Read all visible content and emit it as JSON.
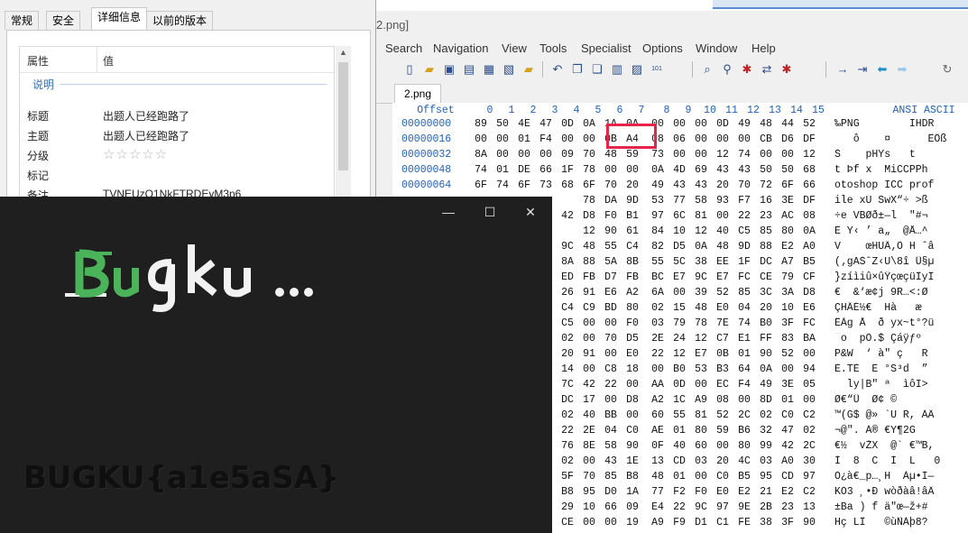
{
  "hex_editor": {
    "title_fragment": "2.png]",
    "menu": [
      "Search",
      "Navigation",
      "View",
      "Tools",
      "Specialist",
      "Options",
      "Window",
      "Help"
    ],
    "tab_label": "2.png",
    "header": {
      "offset": "Offset",
      "columns": [
        "0",
        "1",
        "2",
        "3",
        "4",
        "5",
        "6",
        "7",
        "8",
        "9",
        "10",
        "11",
        "12",
        "13",
        "14",
        "15"
      ],
      "ascii": "ANSI ASCII"
    },
    "rows": [
      {
        "offset": "00000000",
        "hex": [
          "89",
          "50",
          "4E",
          "47",
          "0D",
          "0A",
          "1A",
          "0A",
          "00",
          "00",
          "00",
          "0D",
          "49",
          "48",
          "44",
          "52"
        ],
        "ascii": "‰PNG        IHDR"
      },
      {
        "offset": "00000016",
        "hex": [
          "00",
          "00",
          "01",
          "F4",
          "00",
          "00",
          "0B",
          "A4",
          "08",
          "06",
          "00",
          "00",
          "00",
          "CB",
          "D6",
          "DF"
        ],
        "ascii": "   ô    ¤      ËÖß"
      },
      {
        "offset": "00000032",
        "hex": [
          "8A",
          "00",
          "00",
          "00",
          "09",
          "70",
          "48",
          "59",
          "73",
          "00",
          "00",
          "12",
          "74",
          "00",
          "00",
          "12"
        ],
        "ascii": "Š    pHYs   t  "
      },
      {
        "offset": "00000048",
        "hex": [
          "74",
          "01",
          "DE",
          "66",
          "1F",
          "78",
          "00",
          "00",
          "0A",
          "4D",
          "69",
          "43",
          "43",
          "50",
          "50",
          "68"
        ],
        "ascii": "t Þf x  MiCCPPh"
      },
      {
        "offset": "00000064",
        "hex": [
          "6F",
          "74",
          "6F",
          "73",
          "68",
          "6F",
          "70",
          "20",
          "49",
          "43",
          "43",
          "20",
          "70",
          "72",
          "6F",
          "66"
        ],
        "ascii": "otoshop ICC prof"
      },
      {
        "offset": "",
        "hex": [
          "",
          "",
          "",
          "",
          "",
          "",
          "78",
          "DA",
          "9D",
          "53",
          "77",
          "58",
          "93",
          "F7",
          "16",
          "3E",
          "DF"
        ],
        "ascii": "ile xÚ SwX“÷ >ß"
      },
      {
        "offset": "",
        "hex": [
          "",
          "",
          "",
          "",
          "",
          "",
          "42",
          "D8",
          "F0",
          "B1",
          "97",
          "6C",
          "81",
          "00",
          "22",
          "23",
          "AC",
          "08"
        ],
        "ascii": "÷e VBØð±—l  \"#¬"
      },
      {
        "offset": "",
        "hex": [
          "",
          "",
          "",
          "",
          "",
          "",
          "12",
          "90",
          "61",
          "84",
          "10",
          "12",
          "40",
          "C5",
          "85",
          "80",
          "0A"
        ],
        "ascii": "È Y‹ ’ a„  @Å…^"
      },
      {
        "offset": "",
        "hex": [
          "",
          "",
          "",
          "",
          "",
          "",
          "9C",
          "48",
          "55",
          "C4",
          "82",
          "D5",
          "0A",
          "48",
          "9D",
          "88",
          "E2",
          "A0"
        ],
        "ascii": "V    œHUÄ‚Õ H ˆâ "
      },
      {
        "offset": "",
        "hex": [
          "",
          "",
          "",
          "",
          "",
          "",
          "8A",
          "88",
          "5A",
          "8B",
          "55",
          "5C",
          "38",
          "EE",
          "1F",
          "DC",
          "A7",
          "B5"
        ],
        "ascii": "(‚gAŠˆZ‹U\\8î Ü§µ"
      },
      {
        "offset": "",
        "hex": [
          "",
          "",
          "",
          "",
          "",
          "",
          "ED",
          "FB",
          "D7",
          "FB",
          "BC",
          "E7",
          "9C",
          "E7",
          "FC",
          "CE",
          "79",
          "CF"
        ],
        "ascii": "}zíìiû×ûŸçœçüÎyÏ"
      },
      {
        "offset": "",
        "hex": [
          "",
          "",
          "",
          "",
          "",
          "",
          "26",
          "91",
          "E6",
          "A2",
          "6A",
          "00",
          "39",
          "52",
          "85",
          "3C",
          "3A",
          "D8"
        ],
        "ascii": "€  &‘æ¢j 9R…<:Ø"
      },
      {
        "offset": "",
        "hex": [
          "",
          "",
          "",
          "",
          "",
          "",
          "C4",
          "C9",
          "BD",
          "80",
          "02",
          "15",
          "48",
          "E0",
          "04",
          "20",
          "10",
          "E6"
        ],
        "ascii": "ÇHÄÉ½€  Hà   æ"
      },
      {
        "offset": "",
        "hex": [
          "",
          "",
          "",
          "",
          "",
          "",
          "C5",
          "00",
          "00",
          "F0",
          "03",
          "79",
          "78",
          "7E",
          "74",
          "B0",
          "3F",
          "FC"
        ],
        "ascii": "ËÄg Å  ð yx~t°?ü"
      },
      {
        "offset": "",
        "hex": [
          "",
          "",
          "",
          "",
          "",
          "",
          "02",
          "00",
          "70",
          "D5",
          "2E",
          "24",
          "12",
          "C7",
          "E1",
          "FF",
          "83",
          "BA"
        ],
        "ascii": "¯o  pÕ.$ Çáÿƒº"
      },
      {
        "offset": "",
        "hex": [
          "",
          "",
          "",
          "",
          "",
          "",
          "20",
          "91",
          "00",
          "E0",
          "22",
          "12",
          "E7",
          "0B",
          "01",
          "90",
          "52",
          "00"
        ],
        "ascii": "P&W  ‘ à\" ç   R"
      },
      {
        "offset": "",
        "hex": [
          "",
          "",
          "",
          "",
          "",
          "",
          "14",
          "00",
          "C8",
          "18",
          "00",
          "B0",
          "53",
          "B3",
          "64",
          "0A",
          "00",
          "94"
        ],
        "ascii": "È.TÈ  È °S³d  ”"
      },
      {
        "offset": "",
        "hex": [
          "",
          "",
          "",
          "",
          "",
          "",
          "7C",
          "42",
          "22",
          "00",
          "AA",
          "0D",
          "00",
          "EC",
          "F4",
          "49",
          "3E",
          "05"
        ],
        "ascii": "  ly|B\" ª  ìôI>"
      },
      {
        "offset": "",
        "hex": [
          "",
          "",
          "",
          "",
          "",
          "",
          "DC",
          "17",
          "00",
          "D8",
          "A2",
          "1C",
          "A9",
          "08",
          "00",
          "8D",
          "01",
          "00"
        ],
        "ascii": "Ø€“Ü  Ø¢ ©  "
      },
      {
        "offset": "",
        "hex": [
          "",
          "",
          "",
          "",
          "",
          "",
          "02",
          "40",
          "BB",
          "00",
          "60",
          "55",
          "81",
          "52",
          "2C",
          "02",
          "C0",
          "C2"
        ],
        "ascii": "™(G$ @» `U R, ÀÂ"
      },
      {
        "offset": "",
        "hex": [
          "",
          "",
          "",
          "",
          "",
          "",
          "22",
          "2E",
          "04",
          "C0",
          "AE",
          "01",
          "80",
          "59",
          "B6",
          "32",
          "47",
          "02"
        ],
        "ascii": "¬@\". À® €Y¶2G"
      },
      {
        "offset": "",
        "hex": [
          "",
          "",
          "",
          "",
          "",
          "",
          "76",
          "8E",
          "58",
          "90",
          "0F",
          "40",
          "60",
          "00",
          "80",
          "99",
          "42",
          "2C"
        ],
        "ascii": "€½  vŽX  @` €™B,"
      },
      {
        "offset": "",
        "hex": [
          "",
          "",
          "",
          "",
          "",
          "",
          "02",
          "00",
          "43",
          "1E",
          "13",
          "CD",
          "03",
          "20",
          "4C",
          "03",
          "A0",
          "30"
        ],
        "ascii": "Ì  8  C  Í  L   0"
      },
      {
        "offset": "",
        "hex": [
          "",
          "",
          "",
          "",
          "",
          "",
          "5F",
          "70",
          "85",
          "B8",
          "48",
          "01",
          "00",
          "C0",
          "B5",
          "95",
          "CD",
          "97"
        ],
        "ascii": "Ò¿à€_p…¸H  Àµ•Í—"
      },
      {
        "offset": "",
        "hex": [
          "",
          "",
          "",
          "",
          "",
          "",
          "B8",
          "95",
          "D0",
          "1A",
          "77",
          "F2",
          "F0",
          "E0",
          "E2",
          "21",
          "E2",
          "C2"
        ],
        "ascii": "KÒ3 ¸•Ð wòðàâ!âÂ"
      },
      {
        "offset": "",
        "hex": [
          "",
          "",
          "",
          "",
          "",
          "",
          "17",
          "29",
          "10",
          "66",
          "09",
          "E4",
          "22",
          "9C",
          "97",
          "9E",
          "2B",
          "23",
          "13"
        ],
        "ascii": "±Ba ) f ä\"œ—ž+#"
      },
      {
        "offset": "",
        "hex": [
          "",
          "",
          "",
          "",
          "",
          "",
          "CE",
          "00",
          "00",
          "19",
          "A9",
          "F9",
          "D1",
          "C1",
          "FE",
          "38",
          "3F",
          "90"
        ],
        "ascii": "Hç LÎ   ©ùÑÁþ8?"
      }
    ]
  },
  "properties": {
    "tabs": [
      "常规",
      "安全",
      "详细信息",
      "以前的版本"
    ],
    "active_tab": "详细信息",
    "col_name": "属性",
    "col_value": "值",
    "section": "说明",
    "rows": [
      {
        "key": "标题",
        "value": "出题人已经跑路了"
      },
      {
        "key": "主题",
        "value": "出题人已经跑路了"
      },
      {
        "key": "分级",
        "value": "☆☆☆☆☆"
      },
      {
        "key": "标记",
        "value": ""
      },
      {
        "key": "备注",
        "value": "TVNEUzQ1NkFTRDEyM3p6"
      }
    ]
  },
  "viewer": {
    "logo_text": "Bugku...",
    "flag_text": "BUGKU{a1e5aSA}",
    "controls": {
      "min": "—",
      "max": "☐",
      "close": "✕"
    },
    "colors": {
      "background": "#1f1f1f",
      "logo_green": "#4bb35a",
      "logo_white": "#f2f2f2"
    }
  }
}
